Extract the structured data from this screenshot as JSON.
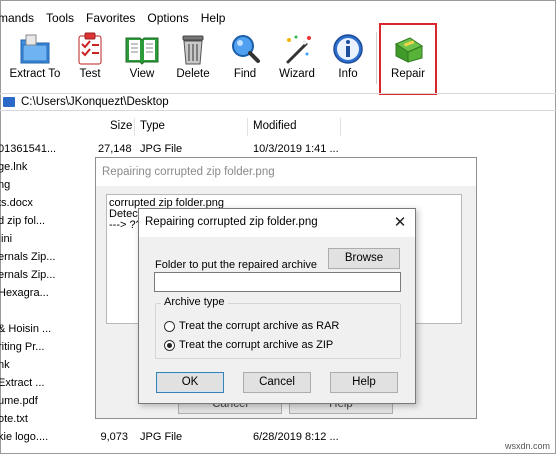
{
  "menu": [
    "mands",
    "Tools",
    "Favorites",
    "Options",
    "Help"
  ],
  "toolbar": [
    {
      "label": "Extract To",
      "icon": "extract-to-icon"
    },
    {
      "label": "Test",
      "icon": "test-clipboard-icon"
    },
    {
      "label": "View",
      "icon": "view-book-icon"
    },
    {
      "label": "Delete",
      "icon": "delete-trash-icon"
    },
    {
      "label": "Find",
      "icon": "find-magnifier-icon"
    },
    {
      "label": "Wizard",
      "icon": "wizard-wand-icon"
    },
    {
      "label": "Info",
      "icon": "info-icon"
    },
    {
      "label": "Repair",
      "icon": "repair-kit-icon"
    }
  ],
  "address": {
    "path": "C:\\Users\\JKonquezt\\Desktop"
  },
  "columns": {
    "size": "Size",
    "type": "Type",
    "modified": "Modified"
  },
  "files": [
    {
      "name": "01361541...",
      "size": "27,148",
      "type": "JPG File",
      "modified": "10/3/2019 1:41 ..."
    },
    {
      "name": "ge.lnk",
      "size": "",
      "type": "",
      "modified": ""
    },
    {
      "name": "ng",
      "size": "",
      "type": "",
      "modified": ""
    },
    {
      "name": "ts.docx",
      "size": "",
      "type": "",
      "modified": ""
    },
    {
      "name": "d zip fol...",
      "size": "",
      "type": "",
      "modified": ""
    },
    {
      "name": ".ini",
      "size": "",
      "type": "",
      "modified": ""
    },
    {
      "name": "ernals Zip...",
      "size": "",
      "type": "",
      "modified": ""
    },
    {
      "name": "ernals Zip...",
      "size": "",
      "type": "",
      "modified": ""
    },
    {
      "name": "Hexagra...",
      "size": "",
      "type": "",
      "modified": ""
    },
    {
      "name": "",
      "size": "",
      "type": "",
      "modified": ""
    },
    {
      "name": "& Hoisin ...",
      "size": "",
      "type": "",
      "modified": ""
    },
    {
      "name": "riting Pr...",
      "size": "",
      "type": "",
      "modified": ""
    },
    {
      "name": "nk",
      "size": "",
      "type": "",
      "modified": ""
    },
    {
      "name": "Extract ...",
      "size": "",
      "type": "",
      "modified": ""
    },
    {
      "name": "ume.pdf",
      "size": "",
      "type": "",
      "modified": ""
    },
    {
      "name": "ote.txt",
      "size": "",
      "type": "",
      "modified": ""
    },
    {
      "name": "kie logo....",
      "size": "9,073",
      "type": "JPG File",
      "modified": "6/28/2019 8:12 ..."
    }
  ],
  "back_dialog": {
    "title": "Repairing corrupted zip folder.png",
    "log": [
      "corrupted zip folder.png",
      "Detecti",
      "---> ??"
    ],
    "btn_cancel": "Cancel",
    "btn_help": "Help"
  },
  "dialog": {
    "title": "Repairing corrupted zip folder.png",
    "folder_label": "Folder to put the repaired archive",
    "folder_value": "",
    "browse_label": "Browse",
    "group_title": "Archive type",
    "radio_rar": "Treat the corrupt archive as RAR",
    "radio_zip": "Treat the corrupt archive as ZIP",
    "selected": "zip",
    "ok_label": "OK",
    "cancel_label": "Cancel",
    "help_label": "Help"
  },
  "watermark": "wsxdn.com",
  "colors": {
    "highlight": "#d9262c",
    "accent": "#2b6ac9"
  }
}
